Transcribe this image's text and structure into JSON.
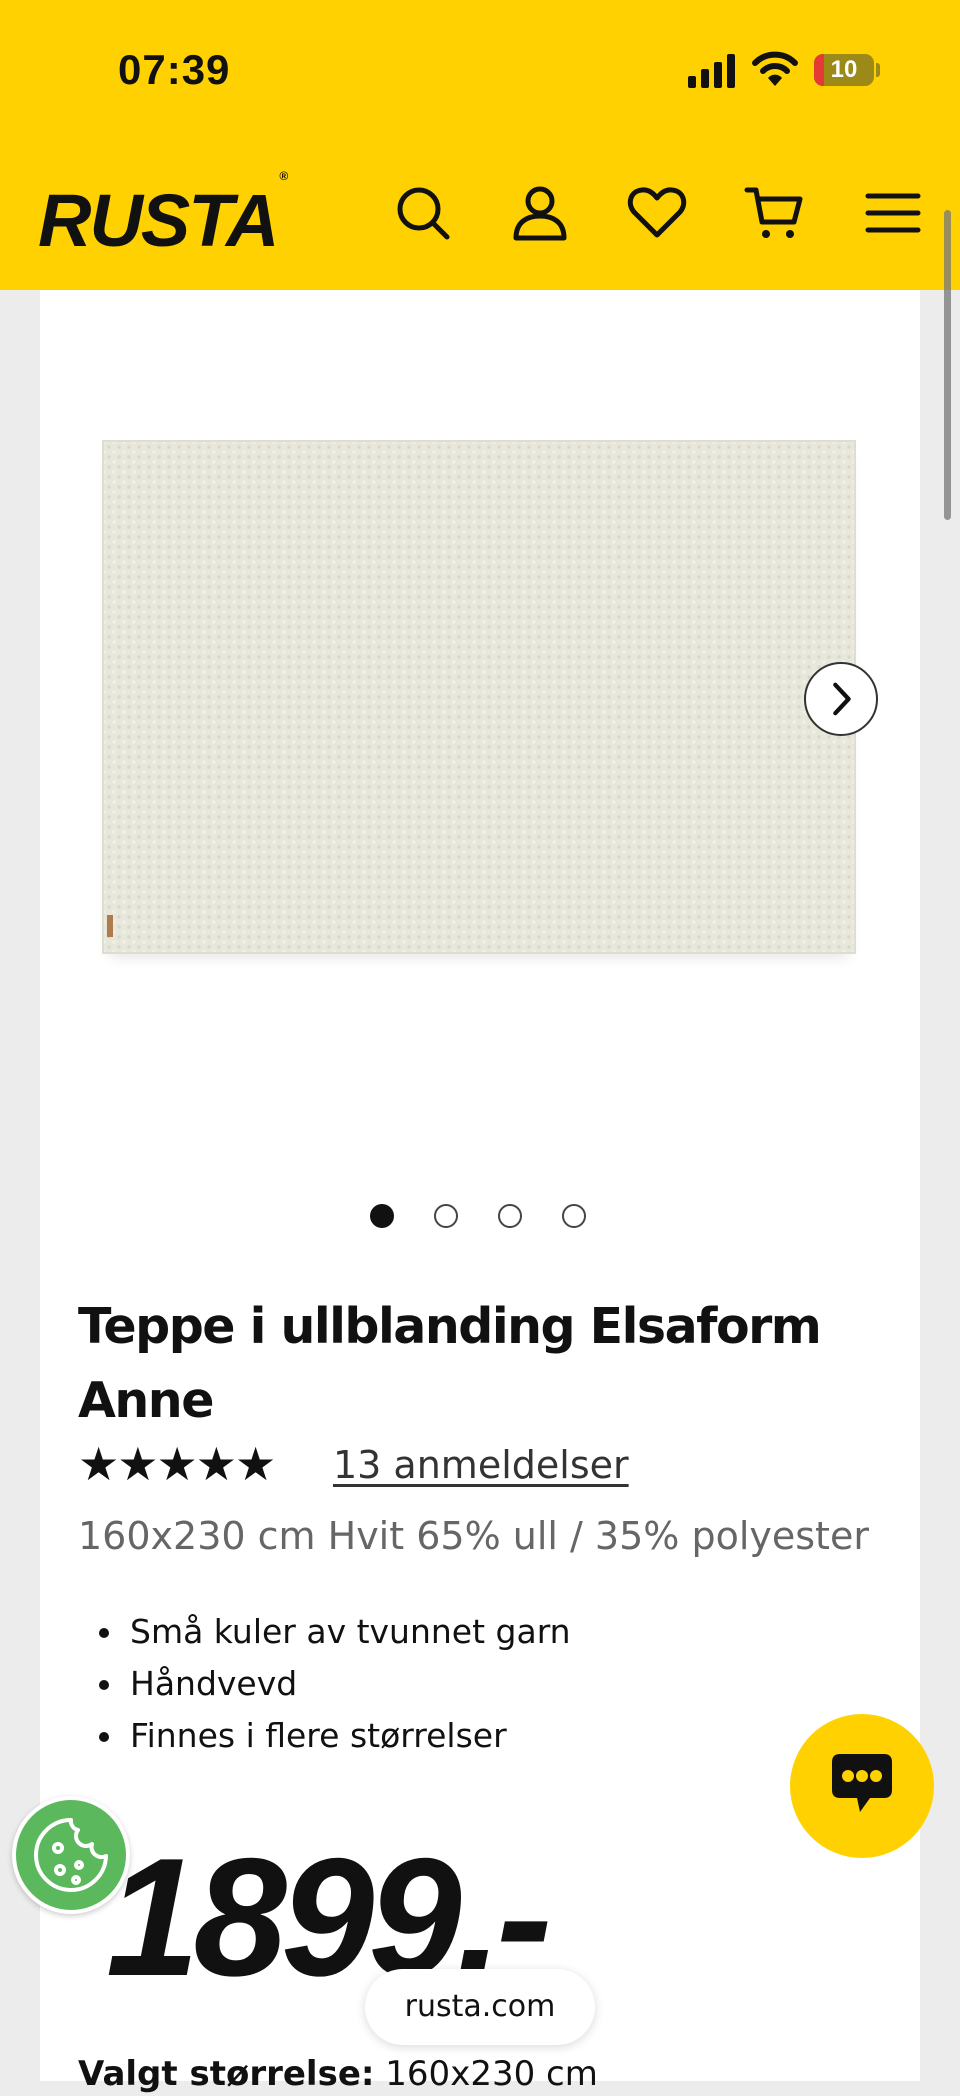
{
  "status_bar": {
    "time": "07:39",
    "battery_level": "10",
    "icons": [
      "signal-icon",
      "wifi-icon",
      "battery-icon"
    ]
  },
  "header": {
    "logo": "RUSTA",
    "logo_mark": "®",
    "icons": [
      "search-icon",
      "account-icon",
      "heart-icon",
      "cart-icon",
      "menu-icon"
    ],
    "background_color": "#ffd100"
  },
  "gallery": {
    "image_alt": "rug",
    "total_images": 4,
    "active_index": 0,
    "next_icon": "chevron-right-icon"
  },
  "product": {
    "title": "Teppe i ullblanding Elsaform Anne",
    "rating": 5,
    "stars": "★★★★★",
    "reviews_link": "13 anmeldelser",
    "subtitle": "160x230 cm Hvit 65% ull / 35% polyester",
    "features": [
      "Små kuler av tvunnet garn",
      "Håndvevd",
      "Finnes i flere størrelser"
    ],
    "price": "1899,-",
    "selected_size_label": "Valgt størrelse:",
    "selected_size_value": "160x230 cm"
  },
  "floating": {
    "chat_icon": "chat-bubble-icon",
    "cookie_icon": "cookie-icon",
    "url": "rusta.com"
  }
}
